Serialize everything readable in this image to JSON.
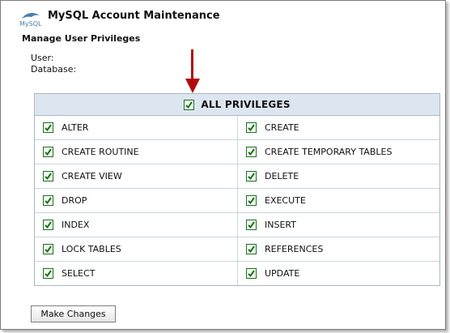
{
  "app": {
    "logo_text": "MySQL",
    "title": "MySQL Account Maintenance"
  },
  "section": {
    "title": "Manage User Privileges",
    "user_label": "User:",
    "database_label": "Database:"
  },
  "privileges": {
    "all_label": "ALL PRIVILEGES",
    "all_checked": true,
    "rows": [
      [
        {
          "label": "ALTER",
          "checked": true
        },
        {
          "label": "CREATE",
          "checked": true
        }
      ],
      [
        {
          "label": "CREATE ROUTINE",
          "checked": true
        },
        {
          "label": "CREATE TEMPORARY TABLES",
          "checked": true
        }
      ],
      [
        {
          "label": "CREATE VIEW",
          "checked": true
        },
        {
          "label": "DELETE",
          "checked": true
        }
      ],
      [
        {
          "label": "DROP",
          "checked": true
        },
        {
          "label": "EXECUTE",
          "checked": true
        }
      ],
      [
        {
          "label": "INDEX",
          "checked": true
        },
        {
          "label": "INSERT",
          "checked": true
        }
      ],
      [
        {
          "label": "LOCK TABLES",
          "checked": true
        },
        {
          "label": "REFERENCES",
          "checked": true
        }
      ],
      [
        {
          "label": "SELECT",
          "checked": true
        },
        {
          "label": "UPDATE",
          "checked": true
        }
      ]
    ]
  },
  "actions": {
    "make_changes_label": "Make Changes"
  },
  "colors": {
    "arrow": "#b30b0b",
    "check": "#1e6e1e",
    "header_bg": "#dde6f0",
    "grid_border": "#aab8c9"
  }
}
